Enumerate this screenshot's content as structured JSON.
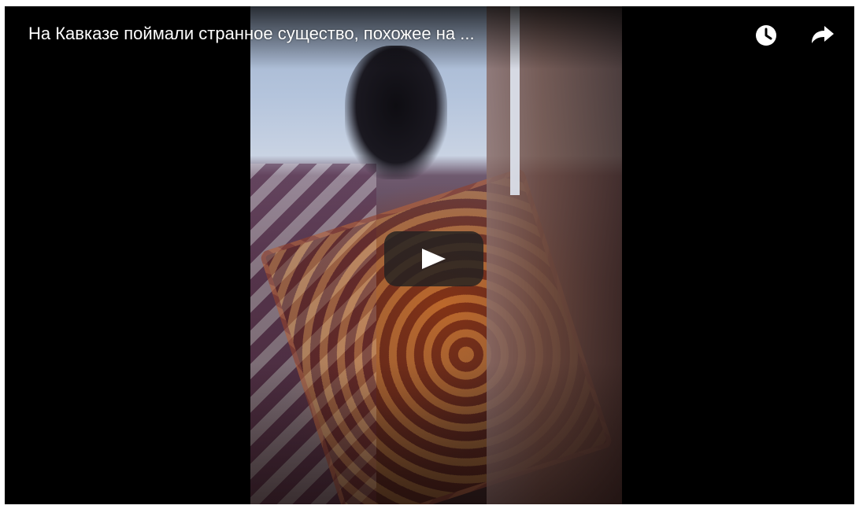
{
  "video": {
    "title": "На Кавказе поймали странное существо, похожее на ..."
  },
  "controls": {
    "watch_later_icon": "clock-icon",
    "share_icon": "share-arrow-icon",
    "play_icon": "play-icon"
  },
  "colors": {
    "play_button_bg": "#212121",
    "title_text": "#ffffff",
    "background": "#000000"
  }
}
